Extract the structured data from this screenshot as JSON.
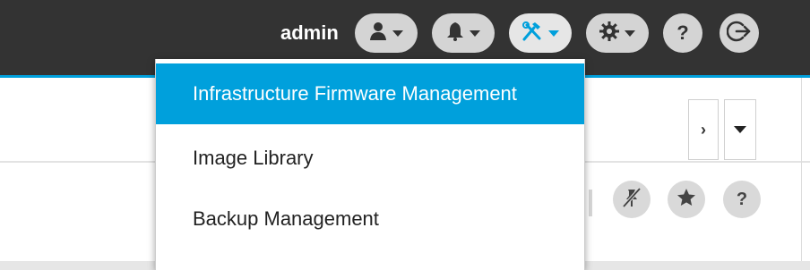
{
  "header": {
    "username": "admin",
    "user_menu_icon": "user-icon",
    "notifications_icon": "bell-icon",
    "tools_icon": "tools-icon",
    "settings_icon": "gear-icon",
    "help_label": "?",
    "logout_icon": "logout-icon",
    "accent_color": "#00a0dc",
    "bar_color": "#333333"
  },
  "tools_menu": {
    "items": [
      {
        "label": "Infrastructure Firmware Management",
        "highlighted": true
      },
      {
        "label": "Image Library",
        "highlighted": false
      },
      {
        "label": "Backup Management",
        "highlighted": false
      }
    ]
  },
  "page": {
    "next_label": "›",
    "action_icons": [
      "unpin-icon",
      "star-icon",
      "help-icon"
    ],
    "help_label": "?"
  }
}
